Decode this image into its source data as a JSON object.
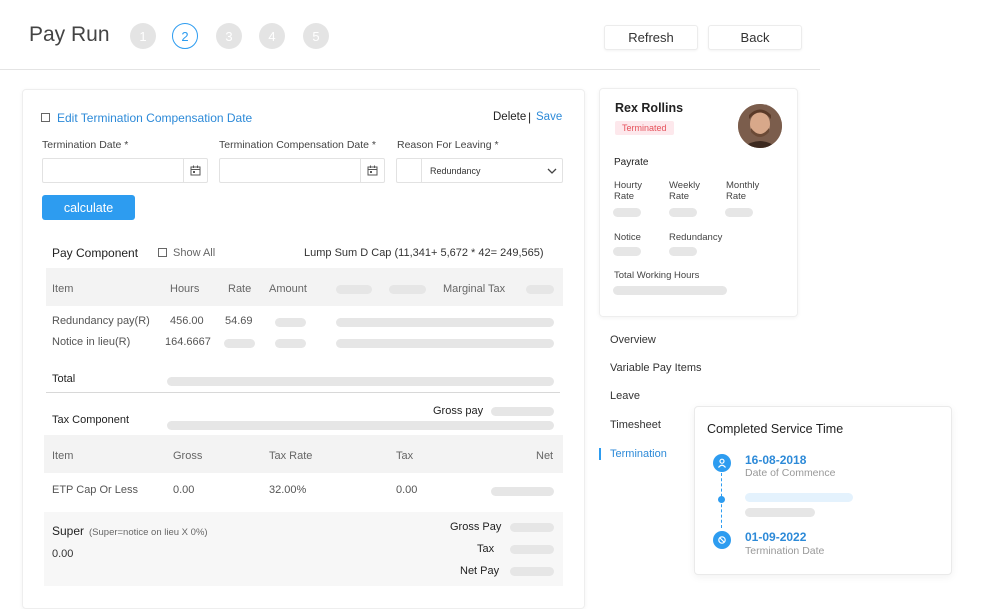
{
  "header": {
    "title": "Pay Run",
    "steps": [
      "1",
      "2",
      "3",
      "4",
      "5"
    ],
    "active_step": 2,
    "refresh_label": "Refresh",
    "back_label": "Back"
  },
  "termination_form": {
    "edit_comp_date_label": "Edit Termination Compensation Date",
    "delete_label": "Delete",
    "separator": "|",
    "save_label": "Save",
    "termination_date_label": "Termination Date *",
    "termination_date_value": "",
    "comp_date_label": "Termination Compensation Date *",
    "comp_date_value": "",
    "reason_label": "Reason For Leaving *",
    "reason_value": "Redundancy",
    "calculate_label": "calculate"
  },
  "pay_component": {
    "title": "Pay Component",
    "show_all_label": "Show All",
    "lump_sum": "Lump Sum D Cap (11,341+ 5,672 * 42= 249,565)",
    "columns": [
      "Item",
      "Hours",
      "Rate",
      "Amount",
      "Marginal Tax"
    ],
    "rows": [
      {
        "item": "Redundancy pay(R)",
        "hours": "456.00",
        "rate": "54.69"
      },
      {
        "item": "Notice in lieu(R)",
        "hours": "164.6667",
        "rate": ""
      }
    ],
    "total_label": "Total"
  },
  "tax_component": {
    "title": "Tax Component",
    "gross_pay_label": "Gross pay",
    "columns": [
      "Item",
      "Gross",
      "Tax Rate",
      "Tax",
      "Net"
    ],
    "rows": [
      {
        "item": "ETP Cap Or Less",
        "gross": "0.00",
        "tax_rate": "32.00%",
        "tax": "0.00"
      }
    ]
  },
  "super": {
    "title": "Super",
    "note": "(Super=notice on lieu X 0%)",
    "value": "0.00",
    "gross_pay_label": "Gross Pay",
    "tax_label": "Tax",
    "net_pay_label": "Net Pay"
  },
  "employee": {
    "name": "Rex Rollins",
    "status": "Terminated",
    "payrate_label": "Payrate",
    "hourly_rate_label": [
      "Hourty",
      "Rate"
    ],
    "weekly_rate_label": [
      "Weekly",
      "Rate"
    ],
    "monthly_rate_label": [
      "Monthly",
      "Rate"
    ],
    "notice_label": "Notice",
    "redundancy_label": "Redundancy",
    "total_working_hours_label": "Total Working Hours"
  },
  "side_nav": {
    "items": [
      "Overview",
      "Variable Pay Items",
      "Leave",
      "Timesheet",
      "Termination"
    ],
    "active": "Termination"
  },
  "service_time": {
    "title": "Completed Service Time",
    "commence_date": "16-08-2018",
    "commence_label": "Date of Commence",
    "termination_date": "01-09-2022",
    "termination_label": "Termination Date"
  },
  "colors": {
    "accent": "#2d9cf0",
    "link": "#2d8ad8",
    "terminated_bg": "#fde8ec",
    "terminated_text": "#e5525c"
  }
}
